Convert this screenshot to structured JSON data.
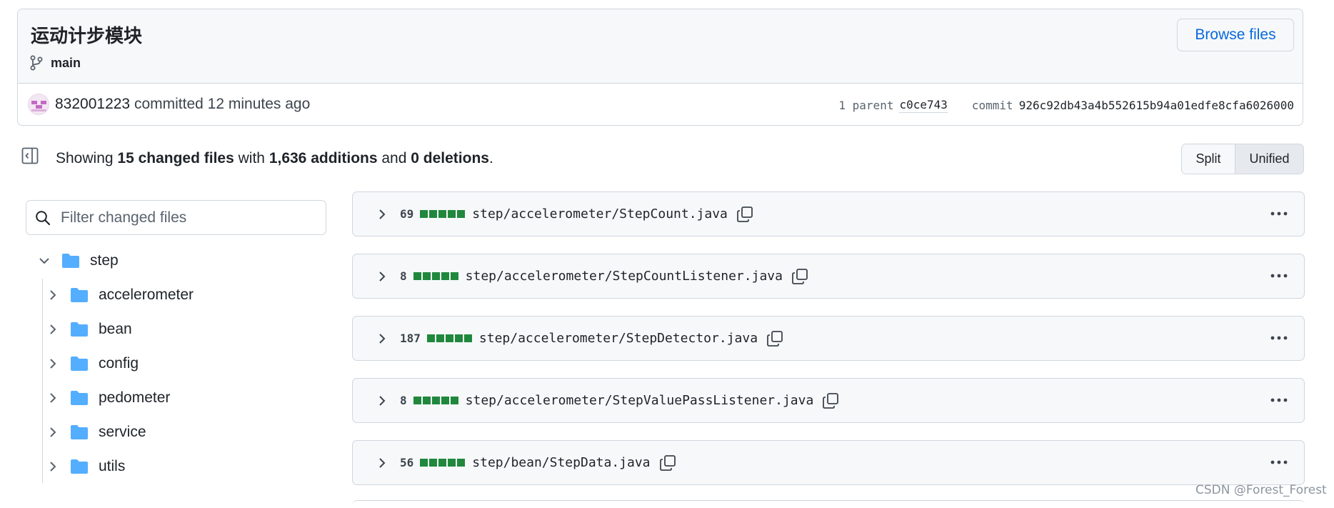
{
  "commit": {
    "title": "运动计步模块",
    "branch": "main",
    "browse_files_label": "Browse files",
    "author": "832001223",
    "action_text": "committed 12 minutes ago",
    "parent_label": "1 parent",
    "parent_sha": "c0ce743",
    "commit_label": "commit",
    "commit_sha": "926c92db43a4b552615b94a01edfe8cfa6026000"
  },
  "summary": {
    "prefix": "Showing ",
    "changed_files": "15 changed files",
    "with": " with ",
    "additions": "1,636 additions",
    "and": " and ",
    "deletions": "0 deletions",
    "suffix": "."
  },
  "view_toggle": {
    "split_label": "Split",
    "unified_label": "Unified",
    "selected": "Unified"
  },
  "filter": {
    "placeholder": "Filter changed files",
    "value": ""
  },
  "file_tree": {
    "root": {
      "label": "step",
      "expanded": true,
      "icon": "folder-icon"
    },
    "children": [
      {
        "label": "accelerometer",
        "expanded": false,
        "icon": "folder-icon"
      },
      {
        "label": "bean",
        "expanded": false,
        "icon": "folder-icon"
      },
      {
        "label": "config",
        "expanded": false,
        "icon": "folder-icon"
      },
      {
        "label": "pedometer",
        "expanded": false,
        "icon": "folder-icon"
      },
      {
        "label": "service",
        "expanded": false,
        "icon": "folder-icon"
      },
      {
        "label": "utils",
        "expanded": false,
        "icon": "folder-icon"
      }
    ]
  },
  "files": [
    {
      "count": "69",
      "path": "step/accelerometer/StepCount.java",
      "diffstat_added_blocks": 5
    },
    {
      "count": "8",
      "path": "step/accelerometer/StepCountListener.java",
      "diffstat_added_blocks": 5
    },
    {
      "count": "187",
      "path": "step/accelerometer/StepDetector.java",
      "diffstat_added_blocks": 5
    },
    {
      "count": "8",
      "path": "step/accelerometer/StepValuePassListener.java",
      "diffstat_added_blocks": 5
    },
    {
      "count": "56",
      "path": "step/bean/StepData.java",
      "diffstat_added_blocks": 5
    }
  ],
  "colors": {
    "addition_green": "#1f883d",
    "link_blue": "#0969da",
    "folder_blue": "#54aeff",
    "border": "#d0d7de"
  },
  "watermark": "CSDN @Forest_Forest"
}
